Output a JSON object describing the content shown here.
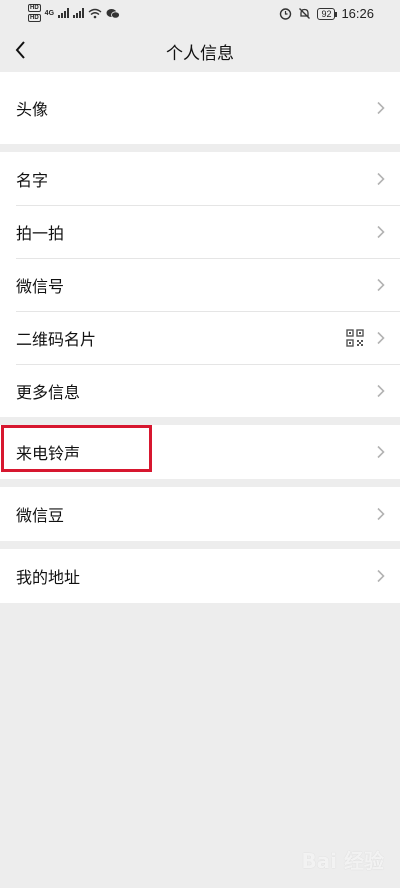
{
  "status_bar": {
    "net_type": "4G",
    "battery": "92",
    "time": "16:26",
    "hd_label_1": "HD",
    "hd_label_2": "HD",
    "icons": [
      "signal-icon",
      "wifi-icon",
      "wechat-icon",
      "alarm-icon",
      "mute-icon"
    ]
  },
  "nav": {
    "title": "个人信息"
  },
  "groups": [
    {
      "items": [
        {
          "label": "头像"
        }
      ]
    },
    {
      "items": [
        {
          "label": "名字"
        },
        {
          "label": "拍一拍"
        },
        {
          "label": "微信号"
        },
        {
          "label": "二维码名片"
        },
        {
          "label": "更多信息"
        }
      ]
    },
    {
      "items": [
        {
          "label": "来电铃声"
        }
      ]
    },
    {
      "items": [
        {
          "label": "微信豆"
        }
      ]
    },
    {
      "items": [
        {
          "label": "我的地址"
        }
      ]
    }
  ],
  "highlight_color": "#d7172f",
  "watermark": "Bai 经验"
}
